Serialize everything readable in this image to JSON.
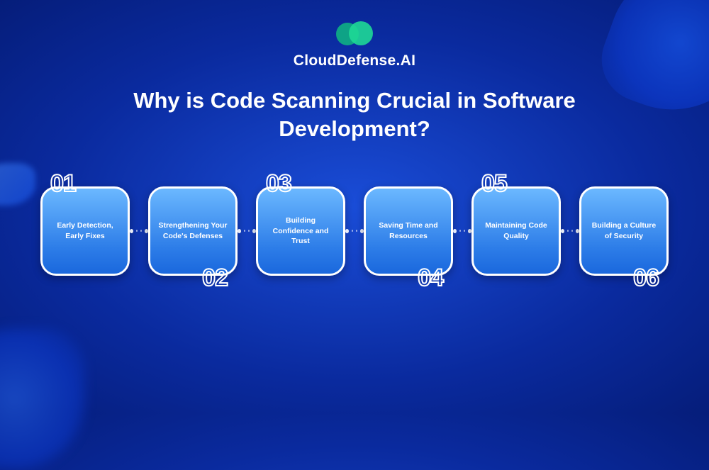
{
  "brand": {
    "name": "CloudDefense.AI"
  },
  "title": "Why is Code Scanning Crucial in Software Development?",
  "steps": [
    {
      "number": "01",
      "position": "top",
      "label": "Early Detection, Early Fixes"
    },
    {
      "number": "02",
      "position": "bottom",
      "label": "Strengthening Your Code's Defenses"
    },
    {
      "number": "03",
      "position": "top",
      "label": "Building Confidence and Trust"
    },
    {
      "number": "04",
      "position": "bottom",
      "label": "Saving Time and Resources"
    },
    {
      "number": "05",
      "position": "top",
      "label": "Maintaining Code Quality"
    },
    {
      "number": "06",
      "position": "bottom",
      "label": "Building a Culture of Security"
    }
  ]
}
